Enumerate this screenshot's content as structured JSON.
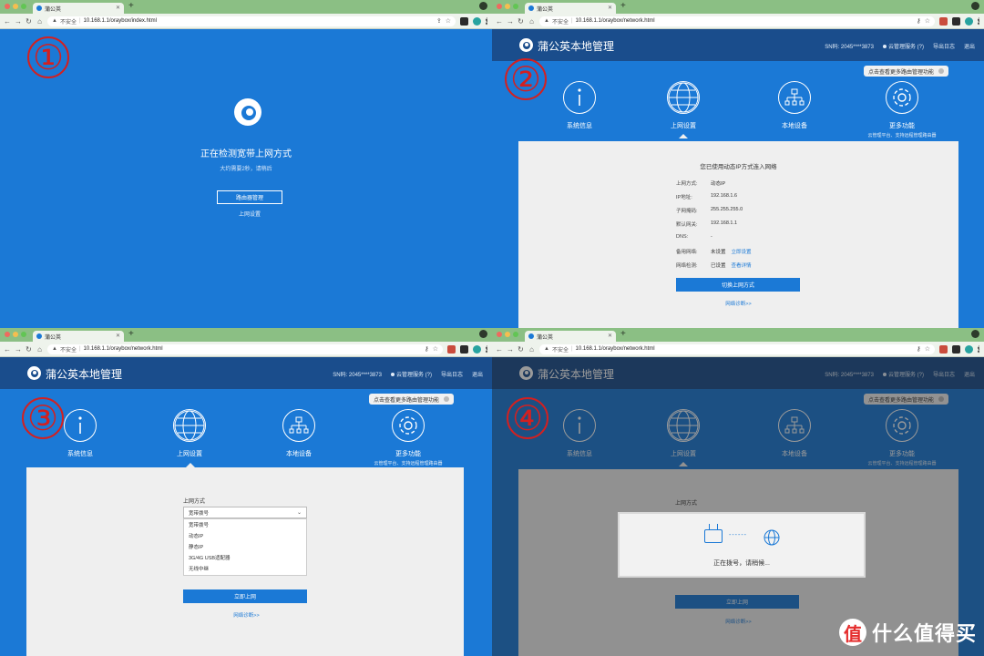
{
  "browser": {
    "tab_title": "蒲公英",
    "new_tab": "+",
    "security_label": "不安全",
    "url_index": "10.168.1.1/oraybox/index.html",
    "url_network": "10.168.1.1/oraybox/network.html"
  },
  "steps": [
    "①",
    "②",
    "③",
    "④"
  ],
  "detect": {
    "title": "正在检测宽带上网方式",
    "subtitle": "大约需要2秒，请稍后",
    "button": "路由器管理",
    "link": "上网设置"
  },
  "admin": {
    "brand": "蒲公英本地管理",
    "sn": "SN码:  2045****3873",
    "cloud": "云管理服务 (?)",
    "export_log": "导出日志",
    "logout": "退出",
    "tooltip": "点击查看更多路由管理功能",
    "nav": [
      {
        "label": "系统信息",
        "icon": "info-icon"
      },
      {
        "label": "上网设置",
        "icon": "globe-icon"
      },
      {
        "label": "本地设备",
        "icon": "network-icon"
      },
      {
        "label": "更多功能",
        "icon": "gear-icon",
        "sub": "云管理平台、支持远程管理路由器"
      }
    ]
  },
  "network_info": {
    "title": "您已使用动态IP方式连入网络",
    "rows": [
      {
        "k": "上网方式:",
        "v": "动态IP"
      },
      {
        "k": "IP地址:",
        "v": "192.168.1.6"
      },
      {
        "k": "子网掩码:",
        "v": "255.255.255.0"
      },
      {
        "k": "默认网关:",
        "v": "192.168.1.1"
      },
      {
        "k": "DNS:",
        "v": "-"
      },
      {
        "k": "备用网络:",
        "v": "未设置",
        "link": "立即设置"
      },
      {
        "k": "网络检测:",
        "v": "已设置",
        "link": "查看详情"
      }
    ],
    "button": "切换上网方式",
    "link": "网络诊断>>"
  },
  "network_select": {
    "label": "上网方式",
    "selected": "宽带拨号",
    "options": [
      "宽带拨号",
      "动态IP",
      "静态IP",
      "3G/4G USB适配器",
      "无线中继"
    ],
    "button": "立即上网",
    "link": "网络诊断>>"
  },
  "dialing": {
    "text": "正在拨号，请稍候...",
    "dashes": "------"
  },
  "watermark": {
    "logo": "值",
    "text": "什么值得买"
  },
  "colors": {
    "page_blue": "#1b79d6",
    "header_navy": "#1a4d8c",
    "badge_red": "#d32020"
  }
}
